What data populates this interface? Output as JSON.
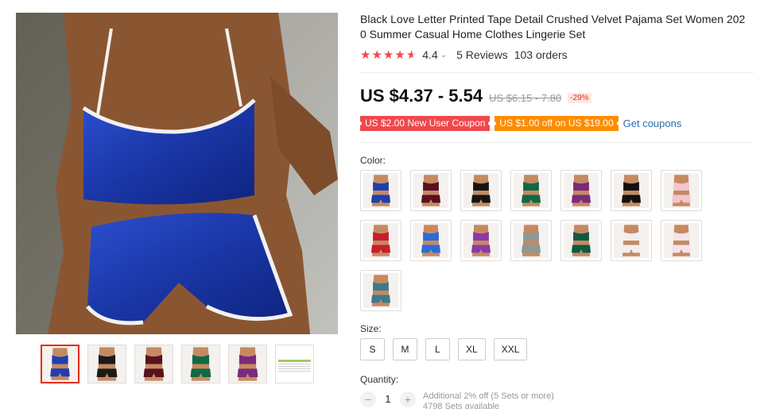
{
  "product": {
    "title": "Black Love Letter Printed Tape Detail Crushed Velvet Pajama Set Women 2020 Summer Casual Home Clothes Lingerie Set",
    "rating": {
      "value": "4.4",
      "stars": 4.5,
      "reviews": "5 Reviews",
      "orders": "103 orders"
    },
    "price": "US $4.37 - 5.54",
    "original_price": "US $6.15 - 7.80",
    "discount": "-29%",
    "coupons": [
      {
        "label": "US $2.00 New User Coupon",
        "color": "#f0484c"
      },
      {
        "label": "US $1.00 off on US $19.00",
        "color": "#ff8c00"
      }
    ],
    "get_coupons_label": "Get coupons"
  },
  "gallery": {
    "main_color": "#1f3fb0",
    "thumbnails": [
      {
        "color": "#1f3fb0",
        "active": true
      },
      {
        "color": "#1a1a1a",
        "active": false
      },
      {
        "color": "#5a1020",
        "active": false
      },
      {
        "color": "#0f6a44",
        "active": false
      },
      {
        "color": "#7a2a7a",
        "active": false
      },
      {
        "color": "size-chart",
        "active": false
      }
    ]
  },
  "options": {
    "color_label": "Color:",
    "colors": [
      "#1f3fb0",
      "#5a1020",
      "#141414",
      "#0f6a44",
      "#7a2a7a",
      "#111111",
      "#f2c6d0",
      "#c81e2c",
      "#2a6cd8",
      "#8a3aa8",
      "#8a9a98",
      "#0e5a40",
      "#efefef",
      "#f4e4ea",
      "#3c7a8c"
    ],
    "size_label": "Size:",
    "sizes": [
      "S",
      "M",
      "L",
      "XL",
      "XXL"
    ],
    "quantity_label": "Quantity:",
    "quantity": "1",
    "minus": "−",
    "plus": "+",
    "bulk_note": "Additional 2% off (5 Sets or more)",
    "available": "4798 Sets available"
  },
  "icons": {
    "rating_chevron": "chevron-down-icon",
    "star": "star-icon"
  }
}
